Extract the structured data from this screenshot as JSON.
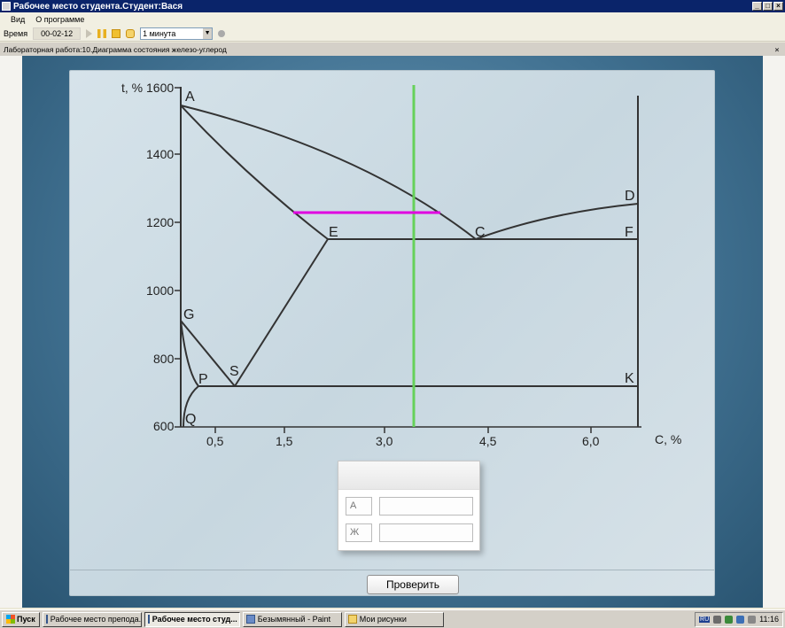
{
  "window": {
    "title": "Рабочее место студента.Студент:Вася"
  },
  "menu": [
    "Вид",
    "О программе"
  ],
  "toolbar": {
    "time_label": "Время",
    "time_value": "00-02-12",
    "interval": "1 минута"
  },
  "doc": {
    "title": "Лабораторная работа:10.Диаграмма состояния железо-углерод"
  },
  "diagram": {
    "y_axis_label": "t, % 1600",
    "x_axis_label": "С, %",
    "y_ticks": [
      "1400",
      "1200",
      "1000",
      "800",
      "600"
    ],
    "x_ticks": [
      "0,5",
      "1,5",
      "3,0",
      "4,5",
      "6,0"
    ],
    "points": [
      "A",
      "E",
      "C",
      "D",
      "F",
      "G",
      "P",
      "S",
      "K",
      "Q"
    ],
    "colors": {
      "lines": "#333333",
      "vertical_marker": "#66D15A",
      "horizontal_marker": "#E000E0"
    }
  },
  "answer": {
    "row1_label": "А",
    "row2_label": "Ж"
  },
  "check_button": "Проверить",
  "taskbar": {
    "start": "Пуск",
    "tasks": [
      "Рабочее место препода...",
      "Рабочее место студ...",
      "Безымянный - Paint",
      "Мои рисунки"
    ],
    "lang": "RU",
    "clock": "11:16"
  }
}
